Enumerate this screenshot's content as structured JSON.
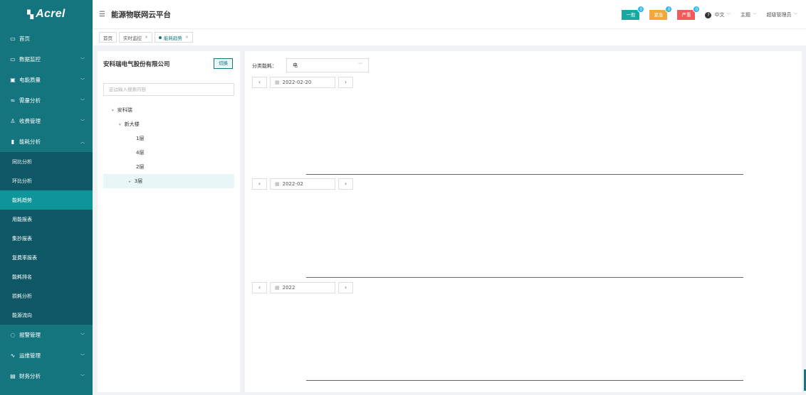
{
  "app": {
    "logo": "Acrel",
    "title": "能源物联网云平台"
  },
  "sidebar": {
    "items": [
      {
        "label": "首页",
        "icon": "monitor-icon",
        "chevron": false
      },
      {
        "label": "数据监控",
        "icon": "monitor-icon",
        "chevron": true
      },
      {
        "label": "电能质量",
        "icon": "screen-icon",
        "chevron": true
      },
      {
        "label": "需量分析",
        "icon": "wave-icon",
        "chevron": true
      },
      {
        "label": "收费管理",
        "icon": "user-icon",
        "chevron": true
      },
      {
        "label": "能耗分析",
        "icon": "bar-chart-icon",
        "chevron": true,
        "expanded": true
      }
    ],
    "subitems": [
      {
        "label": "同比分析"
      },
      {
        "label": "环比分析"
      },
      {
        "label": "能耗趋势",
        "active": true
      },
      {
        "label": "用能报表"
      },
      {
        "label": "集抄报表"
      },
      {
        "label": "复费率报表"
      },
      {
        "label": "能耗排名"
      },
      {
        "label": "损耗分析"
      },
      {
        "label": "能源流向"
      }
    ],
    "bottom_items": [
      {
        "label": "报警管理",
        "icon": "alarm-icon",
        "chevron": true
      },
      {
        "label": "运维管理",
        "icon": "pulse-icon",
        "chevron": true
      },
      {
        "label": "财务分析",
        "icon": "finance-icon",
        "chevron": true
      }
    ]
  },
  "header": {
    "alarms": [
      {
        "label": "一般",
        "count": "0",
        "color": "#17a9a1"
      },
      {
        "label": "紧急",
        "count": "0",
        "color": "#f0a83c"
      },
      {
        "label": "严重",
        "count": "0",
        "color": "#f05a5a"
      }
    ],
    "language": "中文",
    "theme": "主题",
    "user": "超级管理员"
  },
  "tabs": [
    {
      "label": "首页",
      "closable": false,
      "active": false
    },
    {
      "label": "实时监控",
      "closable": true,
      "active": false
    },
    {
      "label": "能耗趋势",
      "closable": true,
      "active": true
    }
  ],
  "tree": {
    "company": "安科瑞电气股份有限公司",
    "switch_label": "切换",
    "search_placeholder": "这边输入搜索内容",
    "nodes": [
      {
        "label": "安科瑞",
        "level": 0,
        "arrow": "expanded"
      },
      {
        "label": "新大楼",
        "level": 1,
        "arrow": "expanded"
      },
      {
        "label": "1层",
        "level": 2,
        "arrow": "none"
      },
      {
        "label": "4层",
        "level": 2,
        "arrow": "none"
      },
      {
        "label": "2层",
        "level": 2,
        "arrow": "none"
      },
      {
        "label": "3层",
        "level": 2,
        "arrow": "collapsed",
        "selected": true
      }
    ]
  },
  "content": {
    "category_label": "分类能耗：",
    "category_value": "电",
    "date_day": "2022-02-20",
    "date_month": "2022-02",
    "date_year": "2022"
  },
  "colors": {
    "sidebar": "#14757f",
    "sidebar_sub": "#0e5866",
    "active": "#0d9599"
  }
}
